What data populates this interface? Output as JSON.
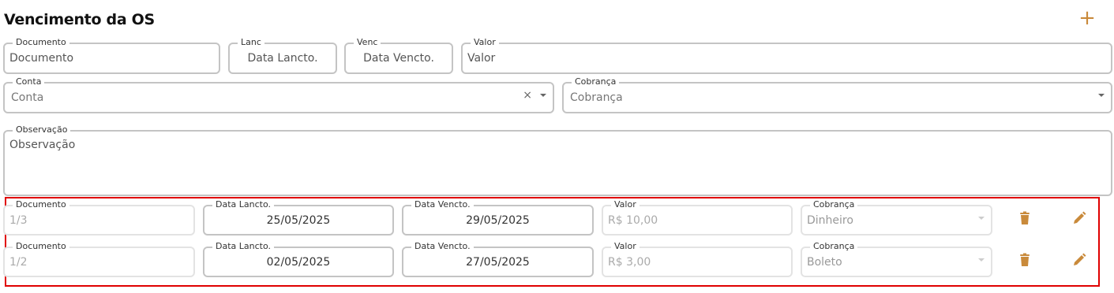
{
  "header": {
    "title": "Vencimento da OS",
    "add_label": "+"
  },
  "form": {
    "documento": {
      "label": "Documento",
      "placeholder": "Documento"
    },
    "lanc": {
      "label": "Lanc",
      "placeholder": "Data Lancto."
    },
    "venc": {
      "label": "Venc",
      "placeholder": "Data Vencto."
    },
    "valor": {
      "label": "Valor",
      "placeholder": "Valor"
    },
    "conta": {
      "label": "Conta",
      "placeholder": "Conta",
      "clear": "×"
    },
    "cobranca": {
      "label": "Cobrança",
      "placeholder": "Cobrança"
    },
    "observacao": {
      "label": "Observação",
      "placeholder": "Observação"
    }
  },
  "rows": [
    {
      "documento_label": "Documento",
      "documento": "1/3",
      "lancto_label": "Data Lancto.",
      "lancto": "25/05/2025",
      "vencto_label": "Data Vencto.",
      "vencto": "29/05/2025",
      "valor_label": "Valor",
      "valor": "R$ 10,00",
      "cobranca_label": "Cobrança",
      "cobranca": "Dinheiro"
    },
    {
      "documento_label": "Documento",
      "documento": "1/2",
      "lancto_label": "Data Lancto.",
      "lancto": "02/05/2025",
      "vencto_label": "Data Vencto.",
      "vencto": "27/05/2025",
      "valor_label": "Valor",
      "valor": "R$ 3,00",
      "cobranca_label": "Cobrança",
      "cobranca": "Boleto"
    }
  ],
  "colors": {
    "accent": "#c98a3b",
    "highlight_border": "#e00000",
    "field_border": "#c4c4c4"
  },
  "icons": {
    "add": "plus-icon",
    "delete": "trash-icon",
    "edit": "pencil-icon"
  }
}
